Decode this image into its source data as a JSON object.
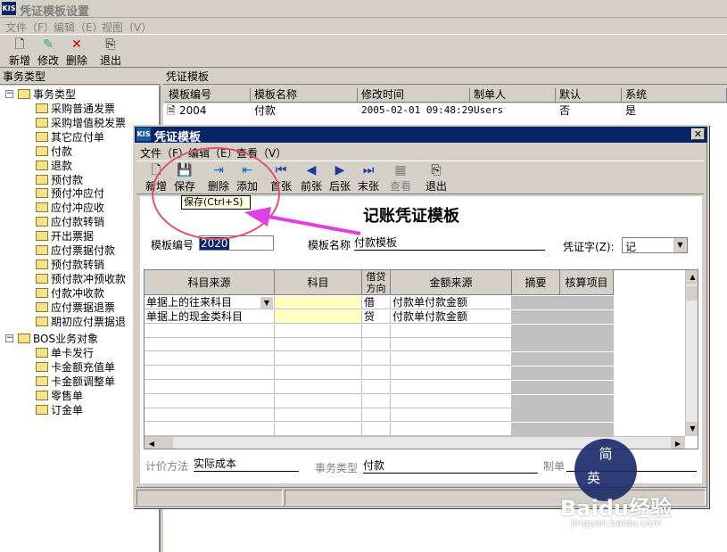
{
  "window": {
    "title": "凭证模板设置",
    "logo": "KIS"
  },
  "menu": [
    "文件（F）",
    "编辑（E）",
    "视图（V）"
  ],
  "toolbar": [
    {
      "label": "新增",
      "icon": "new-icon"
    },
    {
      "label": "修改",
      "icon": "edit-icon"
    },
    {
      "label": "删除",
      "icon": "delete-icon"
    },
    {
      "label": "退出",
      "icon": "exit-icon"
    }
  ],
  "left_panel": {
    "header": "事务类型",
    "root": "事务类型",
    "items": [
      "采购普通发票",
      "采购增值税发票",
      "其它应付单",
      "付款",
      "退款",
      "预付款",
      "预付冲应付",
      "应付冲应收",
      "应付款转销",
      "开出票据",
      "应付票据付款",
      "预付款转销",
      "预付款冲预收款",
      "付款冲收款",
      "应付票据退票",
      "期初应付票据退"
    ],
    "root2": "BOS业务对象",
    "items2": [
      "单卡发行",
      "卡金额充值单",
      "卡金额调整单",
      "零售单",
      "订金单"
    ]
  },
  "right_panel": {
    "header": "凭证模板",
    "columns": [
      "模板编号",
      "模板名称",
      "修改时间",
      "制单人",
      "默认",
      "系统"
    ],
    "rows": [
      [
        "2004",
        "付款",
        "2005-02-01 09:48:29",
        "Users",
        "否",
        "是"
      ]
    ]
  },
  "dialog": {
    "title": "凭证模板",
    "logo": "KIS",
    "menu": [
      "文件（F）",
      "编辑（E）",
      "查看（V）"
    ],
    "toolbar": [
      {
        "label": "新增",
        "icon": "new-icon"
      },
      {
        "label": "保存",
        "icon": "save-icon"
      },
      {
        "label": "删除",
        "icon": "delete-row-icon"
      },
      {
        "label": "添加",
        "icon": "add-row-icon"
      },
      {
        "label": "首张",
        "icon": "first-icon"
      },
      {
        "label": "前张",
        "icon": "prev-icon"
      },
      {
        "label": "后张",
        "icon": "next-icon"
      },
      {
        "label": "末张",
        "icon": "last-icon"
      },
      {
        "label": "查看",
        "icon": "view-icon"
      },
      {
        "label": "退出",
        "icon": "exit-icon"
      }
    ],
    "tooltip": "保存(Ctrl+S)",
    "heading": "记账凭证模板",
    "template_no_label": "模板编号",
    "template_no": "2020",
    "template_name_label": "模板名称",
    "template_name": "付款模板",
    "voucher_word_label": "凭证字(Z):",
    "voucher_word": "记",
    "table": {
      "headers": [
        "科目来源",
        "科目",
        "借贷方向",
        "金额来源",
        "摘要",
        "核算项目"
      ],
      "rows": [
        [
          "单据上的往来科目",
          "",
          "借",
          "付款单付款金额",
          "",
          ""
        ],
        [
          "单据上的现金类科目",
          "",
          "贷",
          "付款单付款金额",
          "",
          ""
        ]
      ]
    },
    "price_method_label": "计价方法",
    "price_method": "实际成本",
    "biz_type_label": "事务类型",
    "biz_type": "付款",
    "maker_label": "制单"
  },
  "watermark": {
    "text": "Baidu经验",
    "url": "jingyan.baidu.com",
    "badge1": "简",
    "badge2": "英"
  },
  "colors": {
    "title_active": "#0a246a",
    "accent": "#e0506a",
    "arrow": "#e040e0"
  }
}
